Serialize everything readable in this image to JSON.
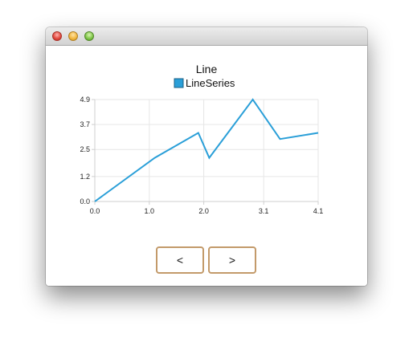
{
  "window": {
    "title": "",
    "controls": [
      "close",
      "minimize",
      "zoom"
    ]
  },
  "colors": {
    "series": "#2a9fd8",
    "grid": "#e6e6e6",
    "axis": "#cfcfcf",
    "button_border": "#c39a6a"
  },
  "chart_data": {
    "type": "line",
    "title": "Line",
    "legend": {
      "placement": "top-center"
    },
    "xlabel": "",
    "ylabel": "",
    "xlim": [
      0.0,
      4.1
    ],
    "ylim": [
      0.0,
      4.9
    ],
    "xticks": [
      "0.0",
      "1.0",
      "2.0",
      "3.1",
      "4.1"
    ],
    "yticks": [
      "0.0",
      "1.2",
      "2.5",
      "3.7",
      "4.9"
    ],
    "grid": true,
    "series": [
      {
        "name": "LineSeries",
        "x": [
          0.0,
          1.1,
          1.9,
          2.1,
          2.9,
          3.4,
          4.1
        ],
        "y": [
          0.0,
          2.1,
          3.3,
          2.1,
          4.9,
          3.0,
          3.3
        ]
      }
    ]
  },
  "buttons": {
    "prev_label": "<",
    "next_label": ">"
  }
}
